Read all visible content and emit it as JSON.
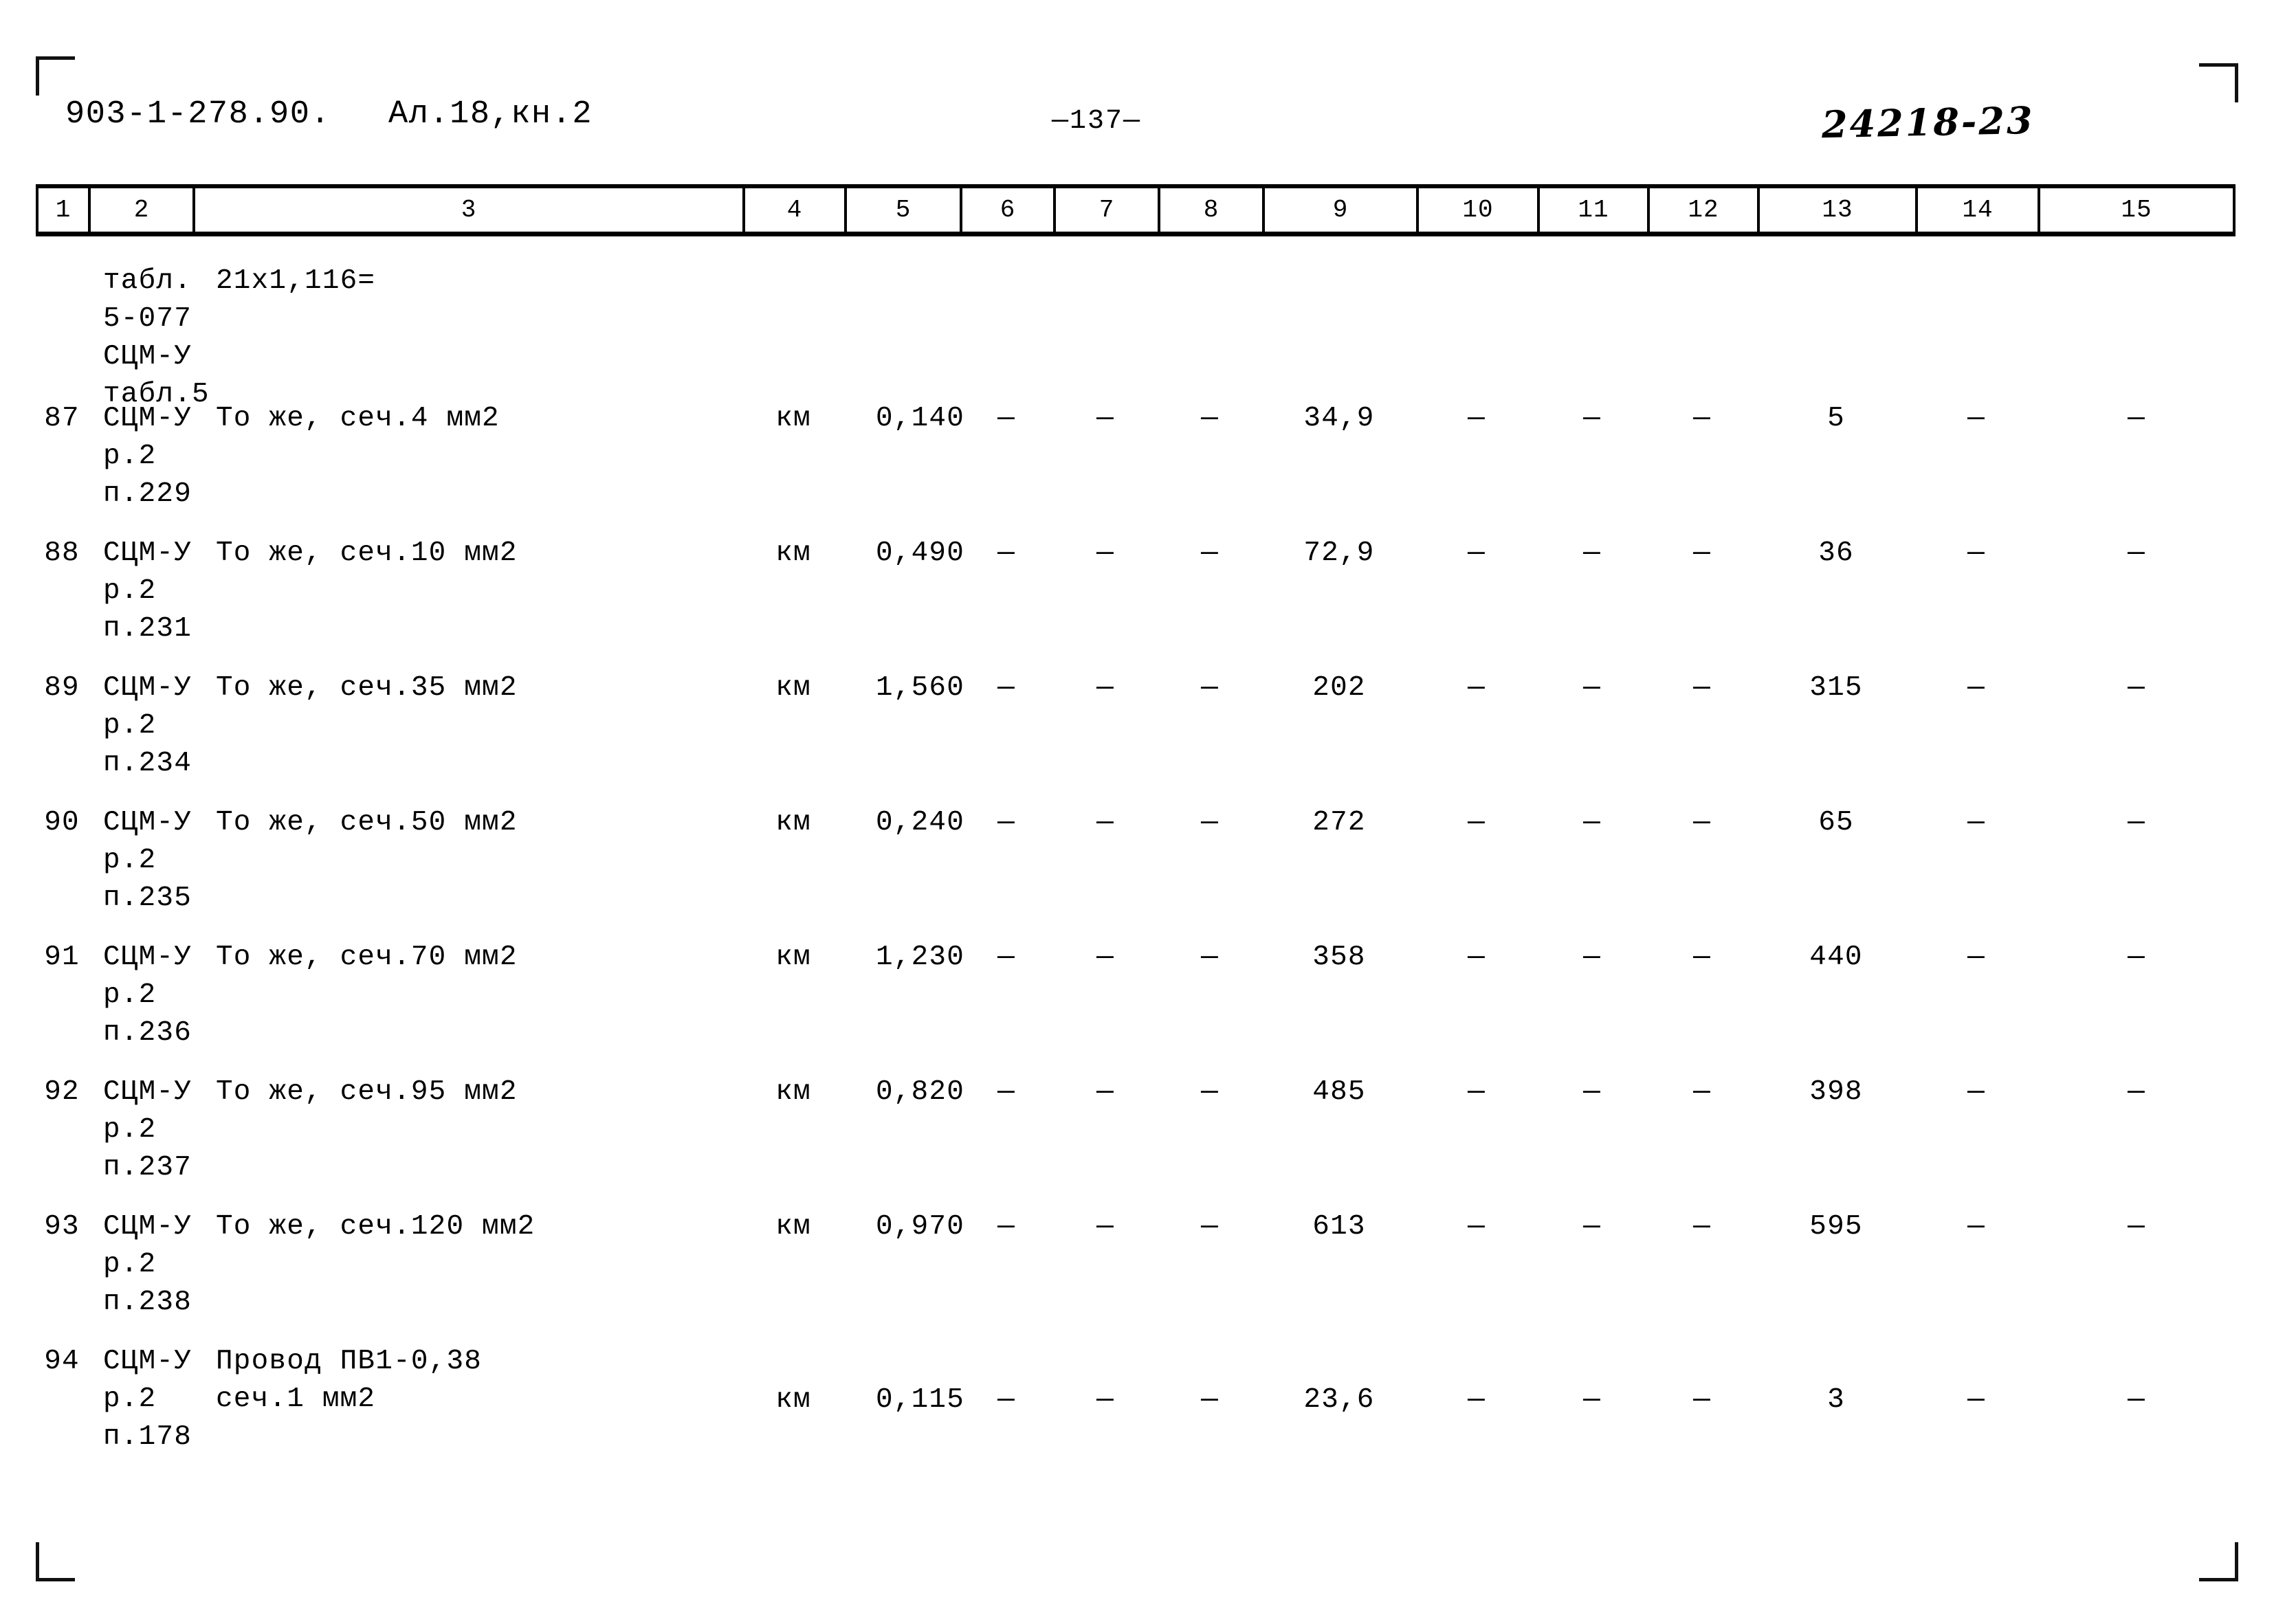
{
  "header": {
    "doc_code": "903-1-278.90.",
    "album": "Ал.18,кн.2",
    "page_number": "—137—",
    "stamp": "24218-23"
  },
  "table": {
    "column_headers": [
      "1",
      "2",
      "3",
      "4",
      "5",
      "6",
      "7",
      "8",
      "9",
      "10",
      "11",
      "12",
      "13",
      "14",
      "15"
    ],
    "rows": [
      {
        "c1": "",
        "c2": "табл.\n5-077\nСЦМ-У\nтабл.5",
        "c3": "21х1,116=",
        "c4": "",
        "c5": "",
        "c6": "",
        "c7": "",
        "c8": "",
        "c9": "",
        "c10": "",
        "c11": "",
        "c12": "",
        "c13": "",
        "c14": "",
        "c15": ""
      },
      {
        "c1": "87",
        "c2": "СЦМ-У\nр.2\nп.229",
        "c3": "То же, сеч.4 мм2",
        "c4": "км",
        "c5": "0,140",
        "c6": "—",
        "c7": "—",
        "c8": "—",
        "c9": "34,9",
        "c10": "—",
        "c11": "—",
        "c12": "—",
        "c13": "5",
        "c14": "—",
        "c15": "—"
      },
      {
        "c1": "88",
        "c2": "СЦМ-У\nр.2\nп.231",
        "c3": "То же, сеч.10 мм2",
        "c4": "км",
        "c5": "0,490",
        "c6": "—",
        "c7": "—",
        "c8": "—",
        "c9": "72,9",
        "c10": "—",
        "c11": "—",
        "c12": "—",
        "c13": "36",
        "c14": "—",
        "c15": "—"
      },
      {
        "c1": "89",
        "c2": "СЦМ-У\nр.2\nп.234",
        "c3": "То же, сеч.35 мм2",
        "c4": "км",
        "c5": "1,560",
        "c6": "—",
        "c7": "—",
        "c8": "—",
        "c9": "202",
        "c10": "—",
        "c11": "—",
        "c12": "—",
        "c13": "315",
        "c14": "—",
        "c15": "—"
      },
      {
        "c1": "90",
        "c2": "СЦМ-У\nр.2\nп.235",
        "c3": "То же, сеч.50 мм2",
        "c4": "км",
        "c5": "0,240",
        "c6": "—",
        "c7": "—",
        "c8": "—",
        "c9": "272",
        "c10": "—",
        "c11": "—",
        "c12": "—",
        "c13": "65",
        "c14": "—",
        "c15": "—"
      },
      {
        "c1": "91",
        "c2": "СЦМ-У\nр.2\nп.236",
        "c3": "То же, сеч.70 мм2",
        "c4": "км",
        "c5": "1,230",
        "c6": "—",
        "c7": "—",
        "c8": "—",
        "c9": "358",
        "c10": "—",
        "c11": "—",
        "c12": "—",
        "c13": "440",
        "c14": "—",
        "c15": "—"
      },
      {
        "c1": "92",
        "c2": "СЦМ-У\nр.2\nп.237",
        "c3": "То же, сеч.95 мм2",
        "c4": "км",
        "c5": "0,820",
        "c6": "—",
        "c7": "—",
        "c8": "—",
        "c9": "485",
        "c10": "—",
        "c11": "—",
        "c12": "—",
        "c13": "398",
        "c14": "—",
        "c15": "—"
      },
      {
        "c1": "93",
        "c2": "СЦМ-У\nр.2\nп.238",
        "c3": "То же, сеч.120 мм2",
        "c4": "км",
        "c5": "0,970",
        "c6": "—",
        "c7": "—",
        "c8": "—",
        "c9": "613",
        "c10": "—",
        "c11": "—",
        "c12": "—",
        "c13": "595",
        "c14": "—",
        "c15": "—"
      },
      {
        "c1": "94",
        "c2": "СЦМ-У\nр.2\nп.178",
        "c3": "Провод ПВ1-0,38\nсеч.1 мм2",
        "c4": "км",
        "c5": "0,115",
        "c6": "—",
        "c7": "—",
        "c8": "—",
        "c9": "23,6",
        "c10": "—",
        "c11": "—",
        "c12": "—",
        "c13": "3",
        "c14": "—",
        "c15": "—"
      }
    ]
  }
}
